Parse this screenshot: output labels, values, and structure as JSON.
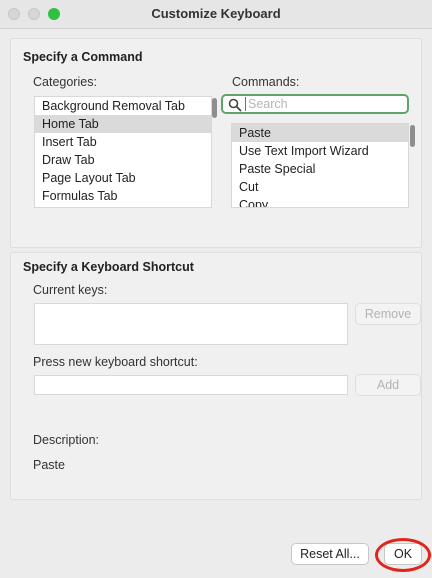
{
  "window": {
    "title": "Customize Keyboard"
  },
  "command_section": {
    "heading": "Specify a Command",
    "categories_label": "Categories:",
    "commands_label": "Commands:",
    "categories": [
      {
        "label": "Background Removal Tab",
        "selected": false
      },
      {
        "label": "Home Tab",
        "selected": true
      },
      {
        "label": "Insert Tab",
        "selected": false
      },
      {
        "label": "Draw Tab",
        "selected": false
      },
      {
        "label": "Page Layout Tab",
        "selected": false
      },
      {
        "label": "Formulas Tab",
        "selected": false
      }
    ],
    "search": {
      "placeholder": "Search",
      "value": ""
    },
    "commands": [
      {
        "label": "Paste",
        "selected": true
      },
      {
        "label": "Use Text Import Wizard",
        "selected": false
      },
      {
        "label": "Paste Special",
        "selected": false
      },
      {
        "label": "Cut",
        "selected": false
      },
      {
        "label": "Copy",
        "selected": false
      }
    ]
  },
  "shortcut_section": {
    "heading": "Specify a Keyboard Shortcut",
    "current_keys_label": "Current keys:",
    "remove_label": "Remove",
    "new_shortcut_label": "Press new keyboard shortcut:",
    "new_shortcut_value": "",
    "add_label": "Add",
    "description_label": "Description:",
    "description_text": "Paste"
  },
  "footer": {
    "reset_label": "Reset All...",
    "ok_label": "OK"
  },
  "colors": {
    "accent_focus": "#5fa36c",
    "highlight_ring": "#e0251d",
    "zoom_button": "#2fc13f"
  }
}
